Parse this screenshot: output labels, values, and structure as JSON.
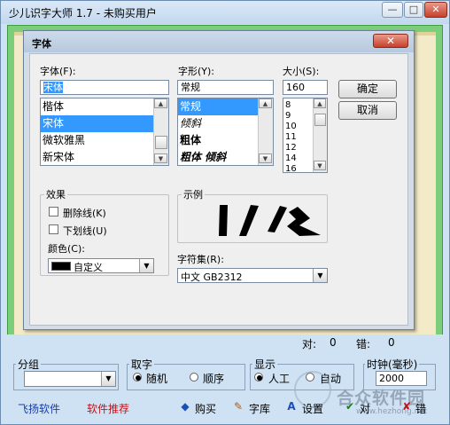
{
  "app": {
    "title": "少儿识字大师 1.7 - 未购买用户",
    "minimize_glyph": "—",
    "maximize_glyph": "□",
    "close_glyph": "✕"
  },
  "dialog": {
    "title": "字体",
    "close_glyph": "✕",
    "font_label": "字体(F):",
    "font_value": "宋体",
    "font_list": [
      "楷体",
      "宋体",
      "微软雅黑",
      "新宋体"
    ],
    "font_selected_index": 1,
    "style_label": "字形(Y):",
    "style_value": "常规",
    "style_list": [
      "常规",
      "倾斜",
      "粗体",
      "粗体 倾斜"
    ],
    "style_selected_index": 0,
    "size_label": "大小(S):",
    "size_value": "160",
    "size_list": [
      "8",
      "9",
      "10",
      "11",
      "12",
      "14",
      "16"
    ],
    "ok_label": "确定",
    "cancel_label": "取消",
    "effects_label": "效果",
    "strikeout_label": "删除线(K)",
    "underline_label": "下划线(U)",
    "color_label": "颜色(C):",
    "color_value": "自定义",
    "color_swatch": "#000000",
    "sample_label": "示例",
    "script_label": "字符集(R):",
    "script_value": "中文 GB2312"
  },
  "score": {
    "correct_label": "对:",
    "correct_value": "0",
    "wrong_label": "错:",
    "wrong_value": "0"
  },
  "bottom": {
    "group_label": "分组",
    "pick_label": "取字",
    "pick_random": "随机",
    "pick_order": "顺序",
    "display_label": "显示",
    "display_manual": "人工",
    "display_auto": "自动",
    "clock_label": "时钟(毫秒)",
    "clock_value": "2000",
    "feiyang": "飞扬软件",
    "recommend": "软件推荐",
    "buy": "购买",
    "library": "字库",
    "settings": "设置",
    "right": "对",
    "wrong": "错",
    "watermark_text": "合众软件园",
    "watermark_url": "www.hezhong.net",
    "colors": {
      "feiyang": "#1a3fa8",
      "recommend": "#c0141c"
    }
  }
}
